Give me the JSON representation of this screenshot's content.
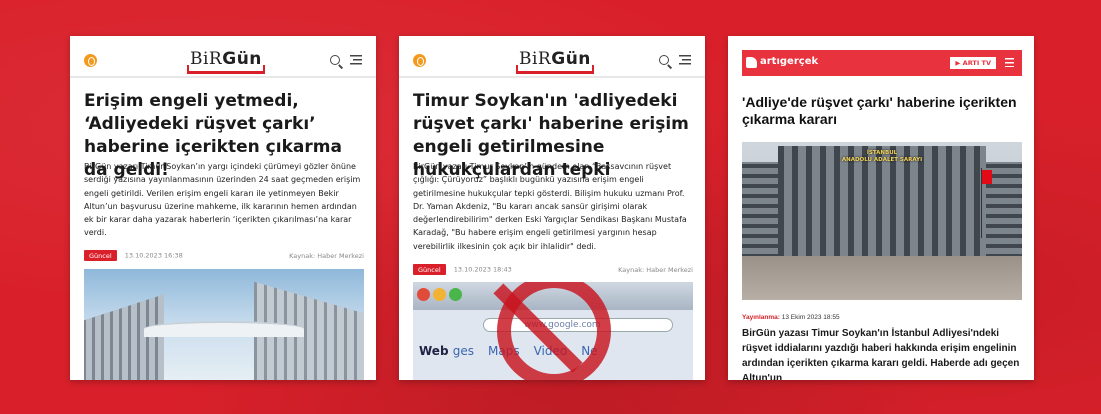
{
  "cards": [
    {
      "brand": {
        "prefix": "BiR",
        "suffix": "Gün"
      },
      "headline": "Erişim engeli yetmedi, ‘Adliyedeki rüşvet çarkı’ haberine içerikten çıkarma da geldi!",
      "body": "BirGün yazarı Timur Soykan’ın yargı içindeki çürümeyi gözler önüne serdiği yazısına yayınlanmasının üzerinden 24 saat geçmeden erişim engeli getirildi. Verilen erişim engeli kararı ile yetinmeyen Bekir Altun’un başvurusu üzerine mahkeme, ilk kararının hemen ardından ek bir karar daha yazarak haberlerin ‘içerikten çıkarılması’na karar verdi.",
      "tag": "Güncel",
      "date": "13.10.2023 16:38",
      "source": "Kaynak: Haber Merkezi"
    },
    {
      "brand": {
        "prefix": "BiR",
        "suffix": "Gün"
      },
      "headline": "Timur Soykan'ın 'adliyedeki rüşvet çarkı' haberine erişim engeli getirilmesine hukukçulardan tepki",
      "body": "BirGün yazarı Timur Soykan’ın gündem olan “Başsavcının rüşvet çığlığı: Çürüyoruz” başlıklı bugünkü yazısına erişim engeli getirilmesine hukukçular tepki gösterdi. Bilişim hukuku uzmanı Prof. Dr. Yaman Akdeniz, \"Bu kararı ancak sansür girişimi olarak değerlendirebilirim\" derken Eski Yargıçlar Sendikası Başkanı Mustafa Karadağ, \"Bu habere erişim engeli getirilmesi yargının hesap verebilirlik ilkesinin çok açık bir ihlalidir\" dedi.",
      "tag": "Güncel",
      "date": "13.10.2023 18:43",
      "source": "Kaynak: Haber Merkezi",
      "photo": {
        "url_text": "www.google.com",
        "web_label": "Web",
        "links": [
          "ges",
          "Maps",
          "Video",
          "Ne"
        ]
      }
    },
    {
      "brand": "artıgerçek",
      "tv_button": "▶ ARTI TV",
      "headline": "'Adliye'de rüşvet çarkı' haberine içerikten çıkarma kararı",
      "photo": {
        "sign_line1": "İSTANBUL",
        "sign_line2": "ANADOLU ADALET SARAYI"
      },
      "meta_label": "Yayınlanma:",
      "meta_date": "13 Ekim 2023 18:55",
      "body": "BirGün yazası Timur Soykan'ın İstanbul Adliyesi'ndeki rüşvet iddialarını yazdığı haberi hakkında erişim engelinin ardından içerikten çıkarma kararı geldi. Haberde adı geçen Altun'un"
    }
  ],
  "colors": {
    "background": "#d9202a",
    "accent": "#e8333f",
    "birgun_logo": "#f39a1e"
  },
  "icons": [
    "birgun-logo-icon",
    "search-icon",
    "menu-icon",
    "artigercek-logo-icon",
    "play-icon",
    "no-sign-icon"
  ]
}
